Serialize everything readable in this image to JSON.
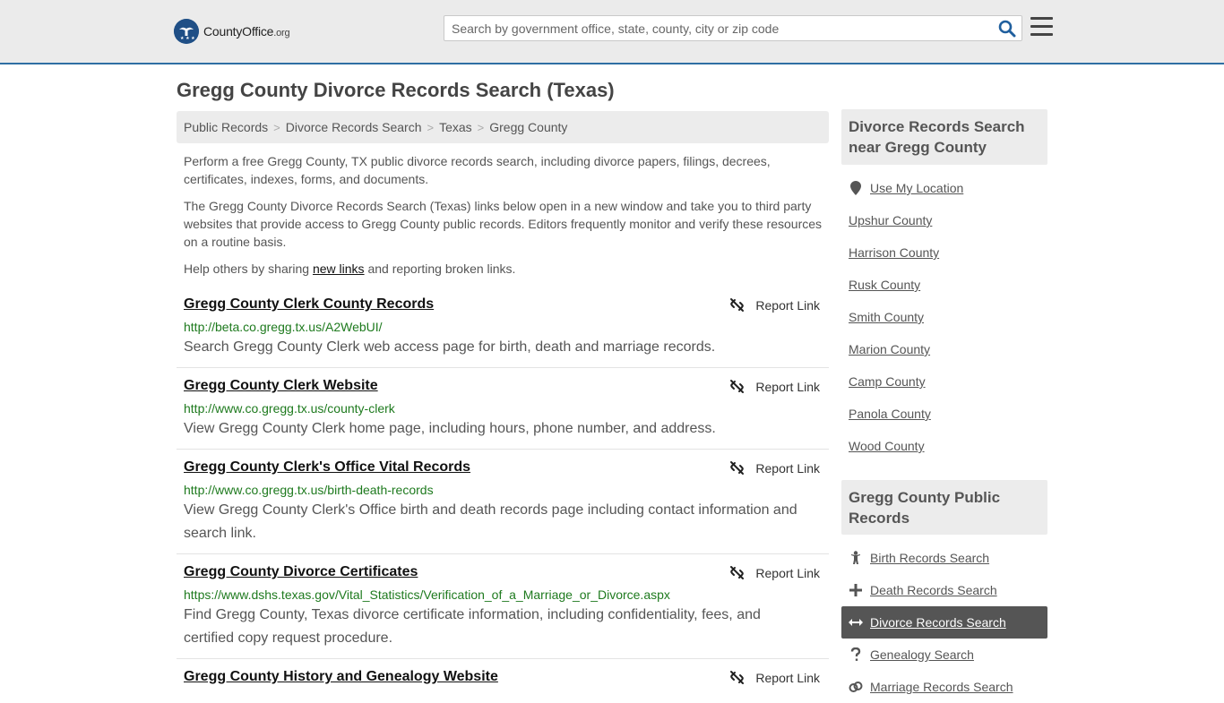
{
  "header": {
    "logo_name": "CountyOffice",
    "logo_tld": ".org",
    "search_placeholder": "Search by government office, state, county, city or zip code"
  },
  "page_title": "Gregg County Divorce Records Search (Texas)",
  "breadcrumb": [
    "Public Records",
    "Divorce Records Search",
    "Texas",
    "Gregg County"
  ],
  "intro": {
    "p1": "Perform a free Gregg County, TX public divorce records search, including divorce papers, filings, decrees, certificates, indexes, forms, and documents.",
    "p2": "The Gregg County Divorce Records Search (Texas) links below open in a new window and take you to third party websites that provide access to Gregg County public records. Editors frequently monitor and verify these resources on a routine basis.",
    "p3_before": "Help others by sharing ",
    "p3_link": "new links",
    "p3_after": " and reporting broken links."
  },
  "report_label": "Report Link",
  "results": [
    {
      "title": "Gregg County Clerk County Records",
      "url": "http://beta.co.gregg.tx.us/A2WebUI/",
      "desc": "Search Gregg County Clerk web access page for birth, death and marriage records."
    },
    {
      "title": "Gregg County Clerk Website",
      "url": "http://www.co.gregg.tx.us/county-clerk",
      "desc": "View Gregg County Clerk home page, including hours, phone number, and address."
    },
    {
      "title": "Gregg County Clerk's Office Vital Records",
      "url": "http://www.co.gregg.tx.us/birth-death-records",
      "desc": "View Gregg County Clerk's Office birth and death records page including contact information and search link."
    },
    {
      "title": "Gregg County Divorce Certificates",
      "url": "https://www.dshs.texas.gov/Vital_Statistics/Verification_of_a_Marriage_or_Divorce.aspx",
      "desc": "Find Gregg County, Texas divorce certificate information, including confidentiality, fees, and certified copy request procedure."
    },
    {
      "title": "Gregg County History and Genealogy Website",
      "url": "",
      "desc": ""
    }
  ],
  "sidebar": {
    "nearby_title": "Divorce Records Search near Gregg County",
    "use_location": "Use My Location",
    "nearby": [
      "Upshur County",
      "Harrison County",
      "Rusk County",
      "Smith County",
      "Marion County",
      "Camp County",
      "Panola County",
      "Wood County"
    ],
    "public_title": "Gregg County Public Records",
    "public": [
      {
        "label": "Birth Records Search",
        "icon": "child-icon"
      },
      {
        "label": "Death Records Search",
        "icon": "cross-icon"
      },
      {
        "label": "Divorce Records Search",
        "icon": "arrows-icon"
      },
      {
        "label": "Genealogy Search",
        "icon": "question-icon"
      },
      {
        "label": "Marriage Records Search",
        "icon": "rings-icon"
      }
    ]
  },
  "colors": {
    "header_bg": "#ebebeb",
    "header_border": "#2f6fa3",
    "url_green": "#1e7a1e",
    "active_bg": "#555555",
    "search_icon": "#1f5f9e"
  }
}
